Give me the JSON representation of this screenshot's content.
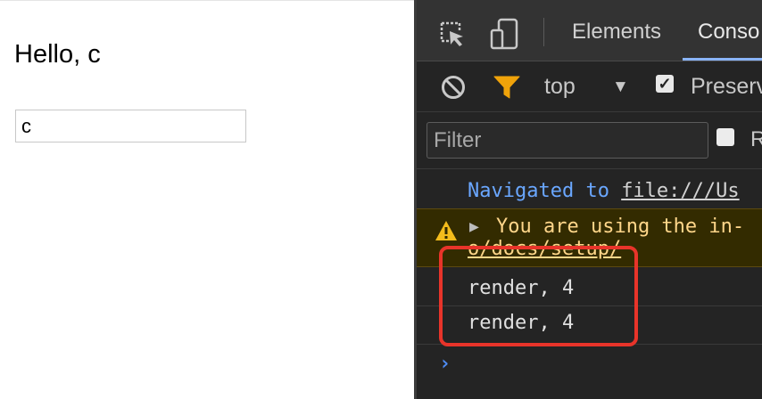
{
  "page": {
    "heading": "Hello, c",
    "input_value": "c"
  },
  "devtools": {
    "tabs": [
      {
        "label": "Elements"
      },
      {
        "label": "Conso"
      }
    ],
    "toolbar": {
      "context": "top",
      "context_arrow": "▼",
      "preserve_label": "Preserv"
    },
    "filter": {
      "placeholder": "Filter",
      "regex_label": "R"
    },
    "console": {
      "nav_prefix": "Navigated to ",
      "nav_url": "file:///Us",
      "warning_expand": "▶",
      "warning_text": "You are using the in-",
      "warning_link": "o/docs/setup/",
      "logs": [
        "render, 4",
        "render, 4"
      ],
      "prompt": "›"
    },
    "colors": {
      "highlight_box": "#e8342a",
      "link_blue": "#6aa7ff",
      "warning_text": "#ffd68a",
      "filter_icon": "#f0a30a"
    }
  }
}
